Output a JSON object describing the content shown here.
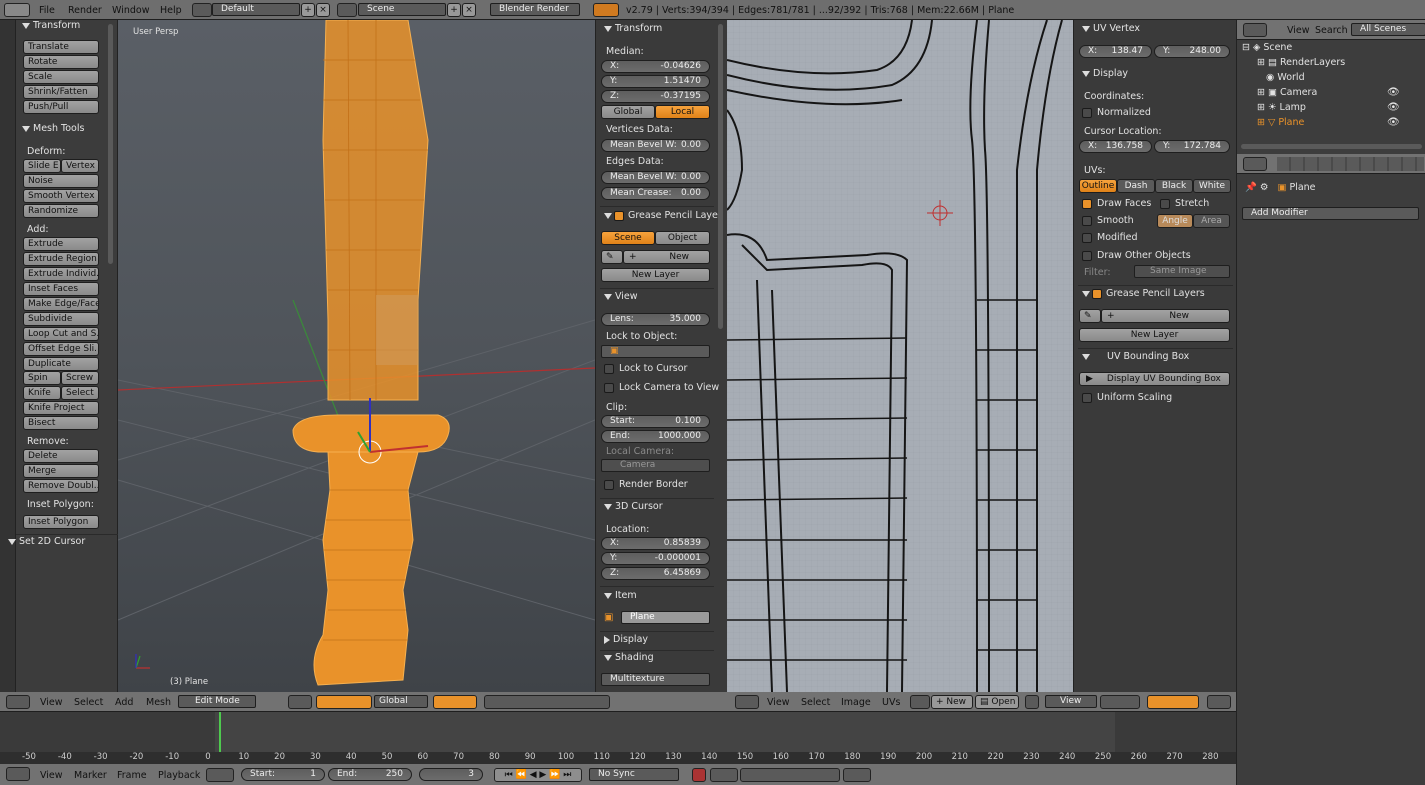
{
  "topbar": {
    "menus": [
      "File",
      "Render",
      "Window",
      "Help"
    ],
    "layout": "Default",
    "scene": "Scene",
    "engine": "Blender Render",
    "stats": "v2.79 | Verts:394/394 | Edges:781/781 | ...92/392 | Tris:768 | Mem:22.66M | Plane"
  },
  "toolshelf": {
    "transform_header": "Transform",
    "transform_buttons": [
      "Translate",
      "Rotate",
      "Scale",
      "Shrink/Fatten",
      "Push/Pull"
    ],
    "mesh_tools_header": "Mesh Tools",
    "deform_label": "Deform:",
    "slide_edge": "Slide E",
    "vertex": "Vertex",
    "deform_buttons": [
      "Noise",
      "Smooth Vertex",
      "Randomize"
    ],
    "add_label": "Add:",
    "extrude": "Extrude",
    "add_buttons": [
      "Extrude Region",
      "Extrude Individ...",
      "Inset Faces",
      "Make Edge/Face",
      "Subdivide",
      "Loop Cut and S...",
      "Offset Edge Sli...",
      "Duplicate"
    ],
    "spin": "Spin",
    "screw": "Screw",
    "knife": "Knife",
    "select": "Select",
    "knife_project": "Knife Project",
    "bisect": "Bisect",
    "remove_label": "Remove:",
    "delete": "Delete",
    "merge": "Merge",
    "remove_doubles": "Remove Doubl...",
    "inset_polygon_label": "Inset Polygon:",
    "inset_polygon": "Inset Polygon",
    "set_2d_cursor": "Set 2D Cursor"
  },
  "viewport": {
    "view_name": "User Persp",
    "object_label": "(3) Plane"
  },
  "npanel": {
    "transform_header": "Transform",
    "median_label": "Median:",
    "x": "X:",
    "x_val": "-0.04626",
    "y": "Y:",
    "y_val": "1.51470",
    "z": "Z:",
    "z_val": "-0.37195",
    "global": "Global",
    "local": "Local",
    "vertices_data": "Vertices Data:",
    "mean_bevel_w": "Mean Bevel W:",
    "mean_bevel_w_val": "0.00",
    "edges_data": "Edges Data:",
    "mean_bevel_w2_val": "0.00",
    "mean_crease": "Mean Crease:",
    "mean_crease_val": "0.00",
    "grease_header": "Grease Pencil Laye",
    "scene": "Scene",
    "object": "Object",
    "new": "New",
    "new_layer": "New Layer",
    "view_header": "View",
    "lens": "Lens:",
    "lens_val": "35.000",
    "lock_to_object": "Lock to Object:",
    "lock_to_cursor": "Lock to Cursor",
    "lock_camera": "Lock Camera to View",
    "clip": "Clip:",
    "start": "Start:",
    "start_val": "0.100",
    "end": "End:",
    "end_val": "1000.000",
    "local_camera": "Local Camera:",
    "camera": "Camera",
    "render_border": "Render Border",
    "cursor_header": "3D Cursor",
    "location": "Location:",
    "cx": "X:",
    "cx_val": "0.85839",
    "cy": "Y:",
    "cy_val": "-0.000001",
    "cz": "Z:",
    "cz_val": "6.45869",
    "item_header": "Item",
    "item_name": "Plane",
    "display_header": "Display",
    "shading_header": "Shading",
    "shading_mode": "Multitexture"
  },
  "uvpanel": {
    "uv_vertex_header": "UV Vertex",
    "x": "X:",
    "x_val": "138.47",
    "y": "Y:",
    "y_val": "248.00",
    "display_header": "Display",
    "coordinates": "Coordinates:",
    "normalized": "Normalized",
    "cursor_location": "Cursor Location:",
    "cx_val": "136.758",
    "cy_val": "172.784",
    "uvs": "UVs:",
    "outline": "Outline",
    "dash": "Dash",
    "black": "Black",
    "white": "White",
    "draw_faces": "Draw Faces",
    "stretch": "Stretch",
    "smooth": "Smooth",
    "angle": "Angle",
    "area": "Area",
    "modified": "Modified",
    "draw_other": "Draw Other Objects",
    "filter": "Filter:",
    "same_image": "Same Image",
    "grease_header": "Grease Pencil Layers",
    "new": "New",
    "new_layer": "New Layer",
    "bbox_header": "UV Bounding Box",
    "display_bbox": "Display UV Bounding Box",
    "uniform_scaling": "Uniform Scaling"
  },
  "outliner": {
    "view": "View",
    "search": "Search",
    "all_scenes": "All Scenes",
    "items": [
      "Scene",
      "RenderLayers",
      "World",
      "Camera",
      "Lamp",
      "Plane"
    ]
  },
  "properties": {
    "object_name": "Plane",
    "add_modifier": "Add Modifier"
  },
  "view3d_header": {
    "view": "View",
    "select": "Select",
    "add": "Add",
    "mesh": "Mesh",
    "mode": "Edit Mode",
    "orientation": "Global"
  },
  "uv_header": {
    "view": "View",
    "select": "Select",
    "image": "Image",
    "uvs": "UVs",
    "new": "New",
    "open": "Open",
    "view2": "View"
  },
  "timeline": {
    "view": "View",
    "marker": "Marker",
    "frame": "Frame",
    "playback": "Playback",
    "start": "Start:",
    "start_val": "1",
    "end": "End:",
    "end_val": "250",
    "current": "3",
    "sync": "No Sync",
    "ticks": [
      "-50",
      "-40",
      "-30",
      "-20",
      "-10",
      "0",
      "10",
      "20",
      "30",
      "40",
      "50",
      "60",
      "70",
      "80",
      "90",
      "100",
      "110",
      "120",
      "130",
      "140",
      "150",
      "160",
      "170",
      "180",
      "190",
      "200",
      "210",
      "220",
      "230",
      "240",
      "250",
      "260",
      "270",
      "280"
    ]
  },
  "colors": {
    "accent": "#e9922a",
    "mesh": "#f0a030",
    "uv_bg": "#a7adb5"
  }
}
